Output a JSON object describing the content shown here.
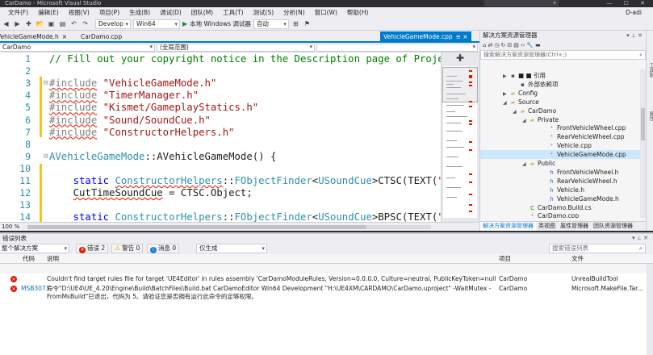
{
  "window": {
    "title": "CarDamo - Microsoft Visual Studio",
    "quick_launch_placeholder": "快速启动 (Ctrl+Q)",
    "controls": "— ☐ ✕"
  },
  "menu": {
    "items": [
      "文件(F)",
      "编辑(E)",
      "视图(V)",
      "项目(P)",
      "生成(B)",
      "调试(D)",
      "团队(M)",
      "工具(T)",
      "测试(S)",
      "分析(N)",
      "窗口(W)",
      "帮助(H)"
    ],
    "user": "D-adi"
  },
  "toolbar": {
    "config": "Develop",
    "platform": "Win64",
    "run_label": "本地 Windows 调试器",
    "run_mode": "自动"
  },
  "editor_tabs": [
    {
      "label": "VehicleGameMode.h",
      "close": "×",
      "active": false
    },
    {
      "label": "CarDamo.cpp",
      "close": "",
      "active": false
    },
    {
      "label": "VehicleGameMode.cpp",
      "close": "≡ ×",
      "active": true
    }
  ],
  "navbar": {
    "project": "CarDamo",
    "scope": "(全局范围)",
    "member": ""
  },
  "code_lines": [
    {
      "n": "1",
      "html": "<span class=\"cm\">// Fill out your copyright notice in the Description page of Project Settings.</span>"
    },
    {
      "n": "2",
      "html": ""
    },
    {
      "n": "3",
      "html": "<span class=\"pp squig\">#include</span> <span class=\"str\">\"VehicleGameMode.h\"</span>"
    },
    {
      "n": "4",
      "html": "<span class=\"pp squig\">#include</span> <span class=\"str\">\"TimerManager.h\"</span>"
    },
    {
      "n": "5",
      "html": "<span class=\"pp squig\">#include</span> <span class=\"str\">\"Kismet/GameplayStatics.h\"</span>"
    },
    {
      "n": "6",
      "html": "<span class=\"pp squig\">#include</span> <span class=\"str\">\"Sound/SoundCue.h\"</span>"
    },
    {
      "n": "7",
      "html": "<span class=\"pp squig\">#include</span> <span class=\"str\">\"ConstructorHelpers.h\"</span>"
    },
    {
      "n": "8",
      "html": ""
    },
    {
      "n": "9",
      "html": "<span class=\"ty\">AVehicleGameMode</span>::AVehicleGameMode() {"
    },
    {
      "n": "10",
      "html": ""
    },
    {
      "n": "11",
      "html": "    <span class=\"kw\">static</span> <span class=\"ty squig\">ConstructorHelpers</span>::<span class=\"ty\">FObjectFinder</span>&lt;<span class=\"ty\">USoundCue</span>&gt;CTSC(TEXT(<span class=\"str\">\"/Game/</span>"
    },
    {
      "n": "12",
      "html": "    <span class=\"squig\">CutTimeSoundCue</span> = CTSC.Object;"
    },
    {
      "n": "13",
      "html": ""
    },
    {
      "n": "14",
      "html": "    <span class=\"kw\">static</span> <span class=\"ty squig\">ConstructorHelpers</span>::<span class=\"ty\">FObjectFinder</span>&lt;<span class=\"ty\">USoundCue</span>&gt;BPSC(TEXT(<span class=\"str\">\"/Game/</span>"
    }
  ],
  "zoom": "100 %",
  "solution_explorer": {
    "title": "解决方案资源管理器",
    "search_placeholder": "搜索解决方案资源管理器(Ctrl+;)",
    "nodes": [
      {
        "label": "■ ■ 引用",
        "icon": "ref",
        "arrow": "▶"
      },
      {
        "label": "外部依赖项",
        "icon": "ref",
        "arrow": ""
      },
      {
        "label": "Config",
        "icon": "folder",
        "arrow": "▶"
      },
      {
        "label": "Source",
        "icon": "folder",
        "arrow": "◢"
      },
      {
        "label": "CarDamo",
        "icon": "folder",
        "arrow": "◢"
      },
      {
        "label": "Private",
        "icon": "folder",
        "arrow": "◢"
      },
      {
        "label": "FrontVehicleWheel.cpp",
        "icon": "cpp",
        "arrow": ""
      },
      {
        "label": "RearVehicleWheel.cpp",
        "icon": "cpp",
        "arrow": ""
      },
      {
        "label": "Vehicle.cpp",
        "icon": "cpp",
        "arrow": ""
      },
      {
        "label": "VehicleGameMode.cpp",
        "icon": "cpp",
        "arrow": ""
      },
      {
        "label": "Public",
        "icon": "folder",
        "arrow": "◢"
      },
      {
        "label": "FrontVehicleWheel.h",
        "icon": "h",
        "arrow": ""
      },
      {
        "label": "RearVehicleWheel.h",
        "icon": "h",
        "arrow": ""
      },
      {
        "label": "Vehicle.h",
        "icon": "h",
        "arrow": ""
      },
      {
        "label": "VehicleGameMode.h",
        "icon": "h",
        "arrow": ""
      },
      {
        "label": "CarDamo.Build.cs",
        "icon": "cs",
        "arrow": ""
      },
      {
        "label": "CarDamo.cpp",
        "icon": "cpp",
        "arrow": ""
      }
    ],
    "bottom_tabs": [
      "解决方案资源管理器",
      "类视图",
      "属性管理器",
      "团队资源管理器"
    ]
  },
  "error_list": {
    "title": "错误列表",
    "scope": "整个解决方案",
    "errors_btn": "错误 2",
    "warnings_btn": "警告 0",
    "messages_btn": "消息 0",
    "build_filter": "仅生成",
    "search_placeholder": "搜索错误列表",
    "columns": {
      "code": "代码",
      "desc": "说明",
      "project": "项目",
      "file": "文件"
    },
    "rows": [
      {
        "code": "",
        "desc1": "Couldn't find target rules file for target 'UE4Editor' in rules assembly 'CarDamoModuleRules, Version=0.0.0.0, Culture=neutral, PublicKeyToken=null'.",
        "desc2": "",
        "project": "CarDamo",
        "file": "UnrealBuildTool"
      },
      {
        "code": "MSB3073",
        "desc1": "命令\"D:\\UE4\\UE_4.20\\Engine\\Build\\BatchFiles\\Build.bat CarDamoEditor Win64 Development \"H:\\UE4XM\\CARDAMO\\CarDamo.uproject\" -WaitMutex -",
        "desc2": "FromMsBuild\"已退出，代码为 5。请验证您是否拥有运行此命令的足够权限。",
        "project": "CarDamo",
        "file": "Microsoft.MakeFile.Tar..."
      }
    ]
  }
}
